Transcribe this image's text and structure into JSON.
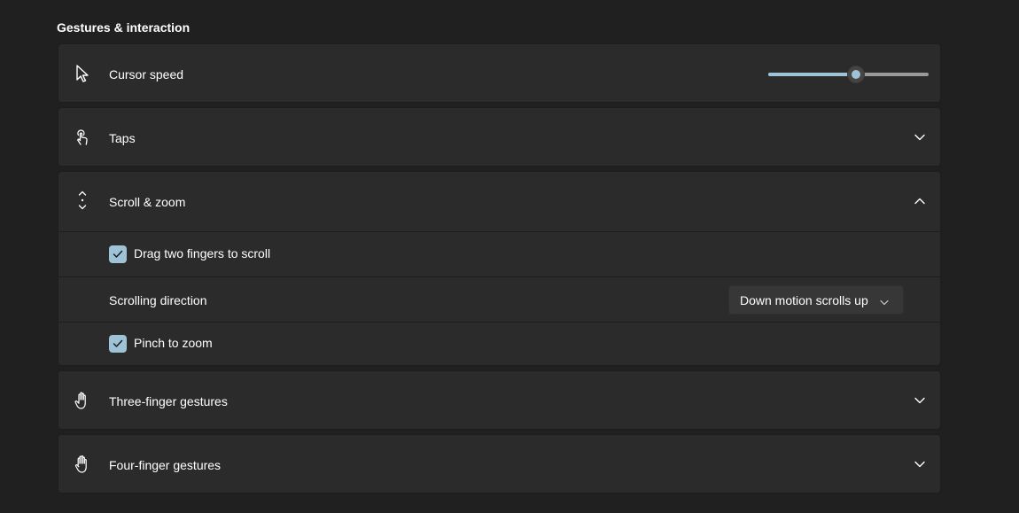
{
  "section": {
    "title": "Gestures & interaction"
  },
  "cursor_speed": {
    "label": "Cursor speed",
    "value": 0.545
  },
  "taps": {
    "label": "Taps"
  },
  "scroll_zoom": {
    "label": "Scroll & zoom",
    "drag_two_fingers": {
      "label": "Drag two fingers to scroll",
      "checked": true
    },
    "scrolling_direction": {
      "label": "Scrolling direction",
      "selected": "Down motion scrolls up"
    },
    "pinch_to_zoom": {
      "label": "Pinch to zoom",
      "checked": true
    }
  },
  "three_finger": {
    "label": "Three-finger gestures"
  },
  "four_finger": {
    "label": "Four-finger gestures"
  },
  "colors": {
    "accent": "#9fc3d6",
    "card": "#2b2b2b",
    "background": "#202020"
  }
}
